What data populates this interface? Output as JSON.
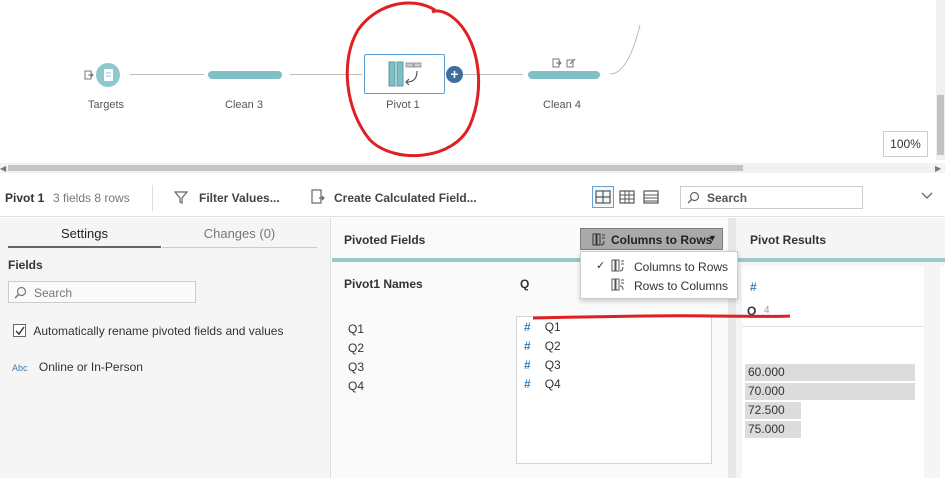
{
  "flow": {
    "nodes": [
      {
        "id": "targets",
        "label": "Targets"
      },
      {
        "id": "clean3",
        "label": "Clean 3"
      },
      {
        "id": "pivot1",
        "label": "Pivot 1"
      },
      {
        "id": "clean4",
        "label": "Clean 4"
      }
    ],
    "add_label": "+",
    "zoom": "100%"
  },
  "toolbar": {
    "step_name": "Pivot 1",
    "step_meta": "3 fields  8 rows",
    "filter_label": "Filter Values...",
    "calc_label": "Create Calculated Field...",
    "search_placeholder": "Search"
  },
  "left": {
    "tabs": [
      "Settings",
      "Changes (0)"
    ],
    "fields_heading": "Fields",
    "search_placeholder": "Search",
    "auto_rename_label": "Automatically rename pivoted fields and values",
    "auto_rename_checked": true,
    "fields": [
      {
        "type_badge": "Abc",
        "name": "Online or In-Person"
      }
    ]
  },
  "middle": {
    "title": "Pivoted Fields",
    "dropdown_label": "Columns to Rows",
    "names_header": "Pivot1 Names",
    "values_header": "Q",
    "names": [
      "Q1",
      "Q2",
      "Q3",
      "Q4"
    ],
    "values": [
      "Q1",
      "Q2",
      "Q3",
      "Q4"
    ]
  },
  "dropdown_menu": {
    "items": [
      {
        "label": "Columns to Rows",
        "checked": true
      },
      {
        "label": "Rows to Columns",
        "checked": false
      }
    ]
  },
  "right": {
    "title": "Pivot Results",
    "field_name": "Q",
    "field_count": "4",
    "values": [
      {
        "label": "60.000",
        "fraction": 1.0
      },
      {
        "label": "70.000",
        "fraction": 1.0
      },
      {
        "label": "72.500",
        "fraction": 0.33
      },
      {
        "label": "75.000",
        "fraction": 0.33
      }
    ]
  },
  "colors": {
    "accent": "#7fbfc6",
    "node_border": "#5a9ed6",
    "plus": "#3d6f9e",
    "annotation": "#e02020"
  }
}
